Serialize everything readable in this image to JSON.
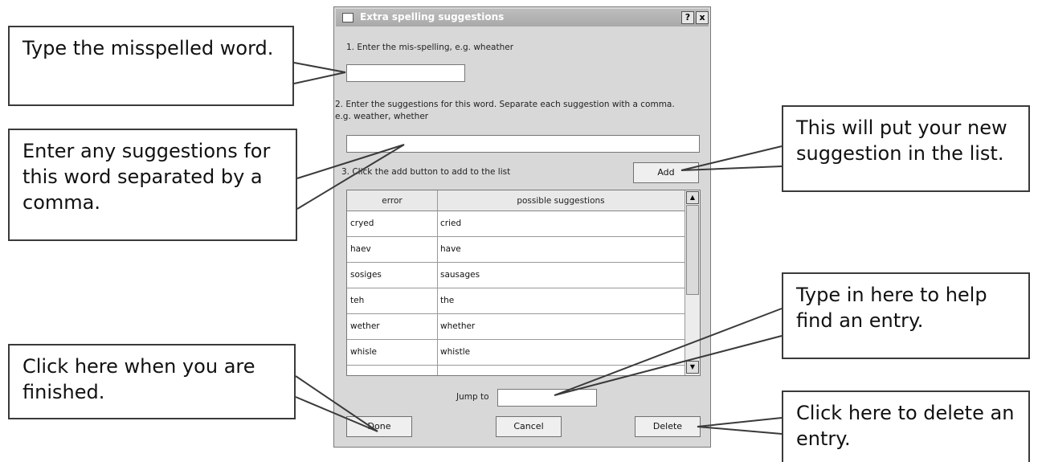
{
  "dialog": {
    "title": "Extra spelling suggestions",
    "help_button": "?",
    "close_button": "x",
    "step1_label": "1. Enter the mis-spelling, e.g. wheather",
    "misspelling_value": "",
    "step2_label_line1": "2. Enter the suggestions for this word. Separate each suggestion with a comma.",
    "step2_label_line2": "e.g. weather, whether",
    "suggestions_value": "",
    "step3_label": "3. Click the add button to add to the list",
    "add_button": "Add",
    "table": {
      "columns": [
        "error",
        "possible suggestions"
      ],
      "rows": [
        [
          "cryed",
          "cried"
        ],
        [
          "haev",
          "have"
        ],
        [
          "sosiges",
          "sausages"
        ],
        [
          "teh",
          "the"
        ],
        [
          "wether",
          "whether"
        ],
        [
          "whisle",
          "whistle"
        ]
      ]
    },
    "jump_to_label": "Jump to",
    "jump_to_value": "",
    "done_button": "Done",
    "cancel_button": "Cancel",
    "delete_button": "Delete"
  },
  "callouts": {
    "misspelled": "Type the misspelled word.",
    "suggestions": "Enter any suggestions for this word separated by a comma.",
    "finished": "Click here when you are finished.",
    "add": "This will put your new suggestion in the list.",
    "find": "Type in here to help find an entry.",
    "delete": "Click here to delete an entry."
  }
}
